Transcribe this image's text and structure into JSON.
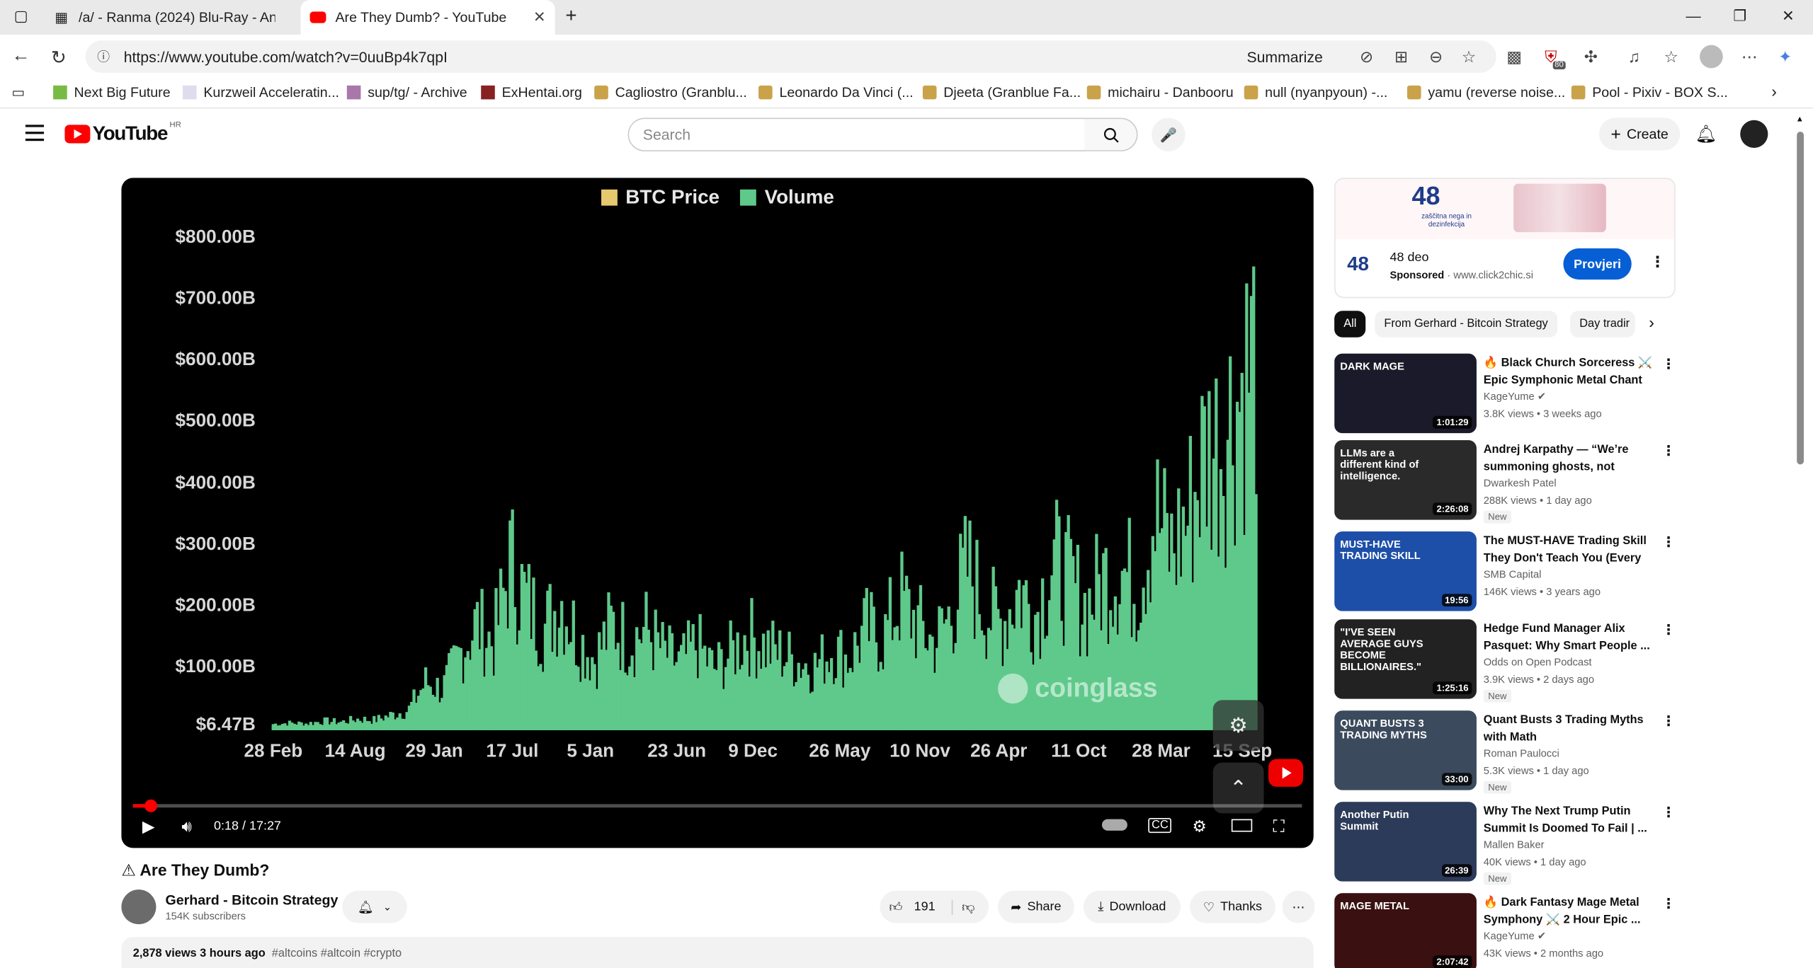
{
  "browser": {
    "tabs": [
      {
        "title": "/a/ - Ranma (2024) Blu-Ray - Anim",
        "active": false
      },
      {
        "title": "Are They Dumb? - YouTube",
        "active": true
      }
    ],
    "url": "https://www.youtube.com/watch?v=0uuBp4k7qpI",
    "summarize_label": "Summarize",
    "extension_badge": "80",
    "bookmarks": [
      "Next Big Future",
      "Kurzweil Acceleratin...",
      "sup/tg/ - Archive",
      "ExHentai.org",
      "Cagliostro (Granblu...",
      "Leonardo Da Vinci (...",
      "Djeeta (Granblue Fa...",
      "michairu - Danbooru",
      "null (nyanpyoun) -...",
      "yamu (reverse noise...",
      "Pool - Pixiv - BOX S..."
    ]
  },
  "youtube": {
    "logo_text": "YouTube",
    "region": "HR",
    "search_placeholder": "Search",
    "create_label": "Create"
  },
  "player": {
    "time": "0:18 / 17:27",
    "progress_fraction": 0.017
  },
  "chart_data": {
    "type": "bar",
    "legend": [
      "BTC Price",
      "Volume"
    ],
    "legend_colors": [
      "#e6b800",
      "#2fb35f"
    ],
    "y_ticks": [
      "$800.00B",
      "$700.00B",
      "$600.00B",
      "$500.00B",
      "$400.00B",
      "$300.00B",
      "$200.00B",
      "$100.00B",
      "$6.47B"
    ],
    "x_ticks": [
      "28 Feb",
      "14 Aug",
      "29 Jan",
      "17 Jul",
      "5 Jan",
      "23 Jun",
      "9 Dec",
      "26 May",
      "10 Nov",
      "26 Apr",
      "11 Oct",
      "28 Mar",
      "15 Sep"
    ],
    "series": [
      {
        "name": "Volume",
        "values": [
          12,
          14,
          13,
          18,
          16,
          22,
          20,
          30,
          40,
          95,
          80,
          150,
          210,
          170,
          330,
          250,
          200,
          260,
          180,
          140,
          210,
          175,
          200,
          155,
          130,
          170,
          120,
          150,
          190,
          165,
          150,
          135,
          125,
          160,
          140,
          200,
          180,
          260,
          210,
          170,
          230,
          320,
          240,
          210,
          280,
          230,
          330,
          290,
          240,
          300,
          320,
          280,
          430,
          350,
          420,
          550,
          570,
          660,
          750
        ]
      }
    ],
    "ylim": [
      6.47,
      800
    ],
    "watermark": "coinglass"
  },
  "video": {
    "title": "⚠ Are They Dumb?",
    "channel": "Gerhard - Bitcoin Strategy",
    "subscribers": "154K subscribers",
    "likes": "191",
    "share_label": "Share",
    "download_label": "Download",
    "thanks_label": "Thanks",
    "stats": "2,878 views  3 hours ago",
    "tags": "#altcoins #altcoin #crypto"
  },
  "ad": {
    "title": "48 deo",
    "sponsored": "Sponsored",
    "domain": "www.click2chic.si",
    "cta": "Provjeri",
    "logo": "48",
    "banner_big": "48",
    "banner_text": "zaščitna nega in dezinfekcija"
  },
  "chips": [
    "All",
    "From Gerhard - Bitcoin Strategy",
    "Day tradir"
  ],
  "recommendations": [
    {
      "title": "🔥 Black Church Sorceress ⚔️ Epic Symphonic Metal Chant ...",
      "channel": "KageYume ✔",
      "meta": "3.8K views • 3 weeks ago",
      "duration": "1:01:29",
      "new": "",
      "thumb_text": "DARK MAGE",
      "thumb_bg": "#1a1a2a"
    },
    {
      "title": "Andrej Karpathy — “We’re summoning ghosts, not buildi...",
      "channel": "Dwarkesh Patel",
      "meta": "288K views • 1 day ago",
      "duration": "2:26:08",
      "new": "New",
      "thumb_text": "LLMs are a different kind of intelligence.",
      "thumb_bg": "#2a2a2a"
    },
    {
      "title": "The MUST-HAVE Trading Skill They Don't Teach You (Every p...",
      "channel": "SMB Capital",
      "meta": "146K views • 3 years ago",
      "duration": "19:56",
      "new": "",
      "thumb_text": "MUST-HAVE TRADING SKILL",
      "thumb_bg": "#1d4fa8"
    },
    {
      "title": "Hedge Fund Manager Alix Pasquet: Why Smart People ...",
      "channel": "Odds on Open Podcast",
      "meta": "3.9K views • 2 days ago",
      "duration": "1:25:16",
      "new": "New",
      "thumb_text": "\"I'VE SEEN AVERAGE GUYS BECOME BILLIONAIRES.\"",
      "thumb_bg": "#222"
    },
    {
      "title": "Quant Busts 3 Trading Myths with Math",
      "channel": "Roman Paulocci",
      "meta": "5.3K views • 1 day ago",
      "duration": "33:00",
      "new": "New",
      "thumb_text": "QUANT BUSTS 3 TRADING MYTHS",
      "thumb_bg": "#3b4a5c"
    },
    {
      "title": "Why The Next Trump Putin Summit Is Doomed To Fail | ...",
      "channel": "Mallen Baker",
      "meta": "40K views • 1 day ago",
      "duration": "26:39",
      "new": "New",
      "thumb_text": "Another Putin Summit",
      "thumb_bg": "#2d3b5a"
    },
    {
      "title": "🔥 Dark Fantasy Mage Metal Symphony ⚔️ 2 Hour Epic ...",
      "channel": "KageYume ✔",
      "meta": "43K views • 2 months ago",
      "duration": "2:07:42",
      "new": "",
      "thumb_text": "MAGE METAL",
      "thumb_bg": "#3a1010"
    }
  ]
}
